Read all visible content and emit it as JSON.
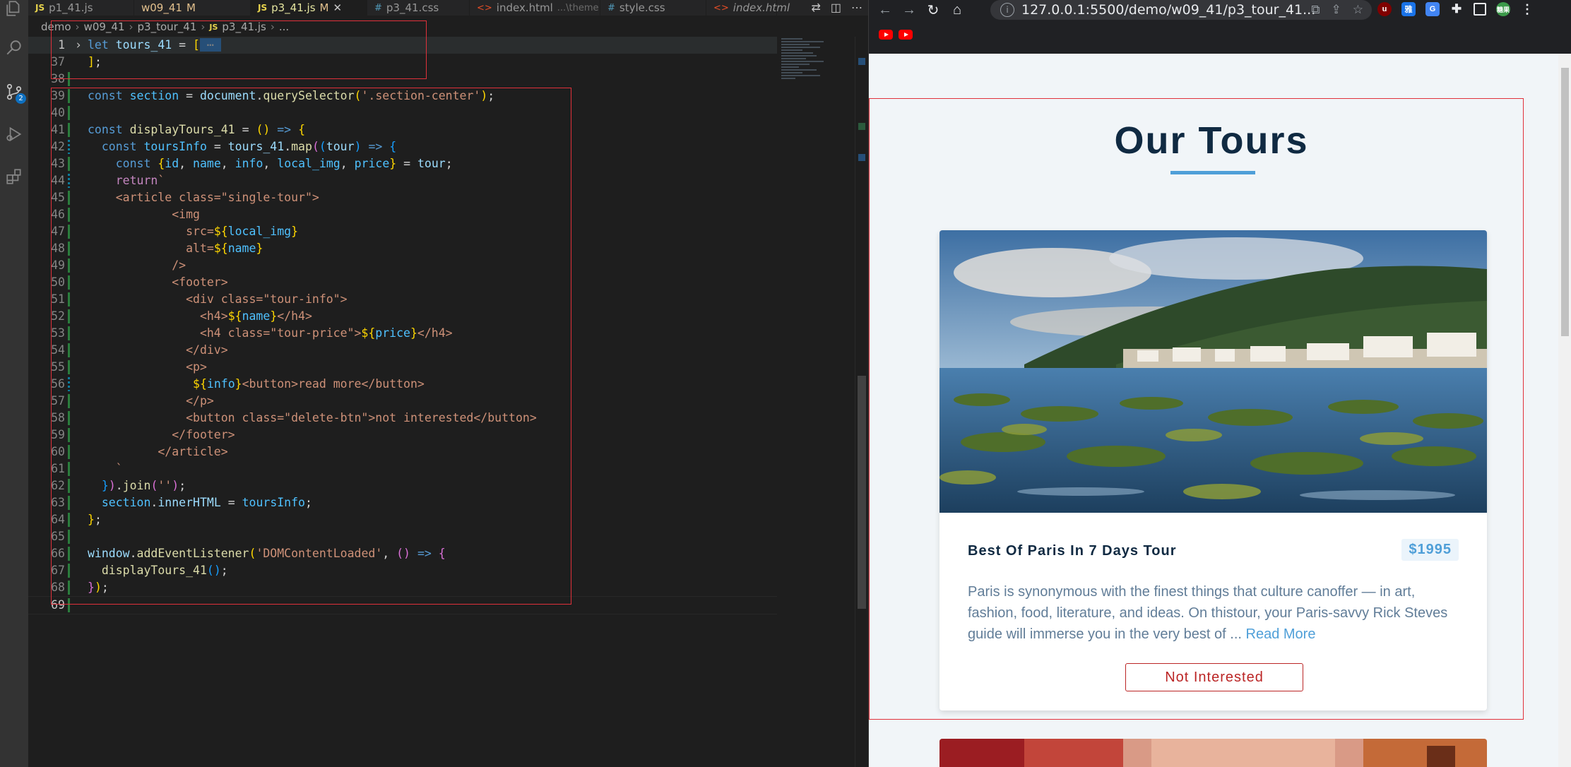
{
  "editor": {
    "tabs": [
      {
        "icon": "JS",
        "label": "p1_41.js",
        "modified": "",
        "sub": ""
      },
      {
        "icon": "",
        "label": "w09_41",
        "modified": "M",
        "sub": ""
      },
      {
        "icon": "JS",
        "label": "p3_41.js",
        "modified": "M",
        "sub": ""
      },
      {
        "icon": "#",
        "label": "p3_41.css",
        "modified": "",
        "sub": ""
      },
      {
        "icon": "<>",
        "label": "index.html",
        "modified": "",
        "sub": "...\\theme"
      },
      {
        "icon": "#",
        "label": "style.css",
        "modified": "",
        "sub": ""
      },
      {
        "icon": "<>",
        "label": "index.html",
        "modified": "",
        "sub": ""
      }
    ],
    "breadcrumb": [
      "demo",
      "w09_41",
      "p3_tour_41",
      "p3_41.js",
      "..."
    ],
    "scm_badge": "2",
    "code_lines": [
      {
        "n": "1"
      },
      {
        "n": "37"
      },
      {
        "n": "38"
      },
      {
        "n": "39"
      },
      {
        "n": "40"
      },
      {
        "n": "41"
      },
      {
        "n": "42"
      },
      {
        "n": "43"
      },
      {
        "n": "44"
      },
      {
        "n": "45"
      },
      {
        "n": "46"
      },
      {
        "n": "47"
      },
      {
        "n": "48"
      },
      {
        "n": "49"
      },
      {
        "n": "50"
      },
      {
        "n": "51"
      },
      {
        "n": "52"
      },
      {
        "n": "53"
      },
      {
        "n": "54"
      },
      {
        "n": "55"
      },
      {
        "n": "56"
      },
      {
        "n": "57"
      },
      {
        "n": "58"
      },
      {
        "n": "59"
      },
      {
        "n": "60"
      },
      {
        "n": "61"
      },
      {
        "n": "62"
      },
      {
        "n": "63"
      },
      {
        "n": "64"
      },
      {
        "n": "65"
      },
      {
        "n": "66"
      },
      {
        "n": "67"
      },
      {
        "n": "68"
      },
      {
        "n": "69"
      }
    ]
  },
  "browser": {
    "url": "127.0.0.1:5500/demo/w09_41/p3_tour_41...",
    "ext_labels": [
      "u",
      "雅",
      "G",
      "",
      "",
      "糖果"
    ],
    "page": {
      "title": "Our Tours",
      "tour": {
        "name": "Best Of Paris In 7 Days Tour",
        "price": "$1995",
        "info": "Paris is synonymous with the finest things that culture canoffer — in art, fashion, food, literature, and ideas. On thistour, your Paris-savvy Rick Steves guide will immerse you in the very best of ... ",
        "read_more": "Read More",
        "not_interested": "Not Interested"
      }
    }
  },
  "colors": {
    "highlight_box": "#e0313b",
    "accent": "#4f9fd8",
    "danger": "#bb2525",
    "heading": "#102a42"
  }
}
